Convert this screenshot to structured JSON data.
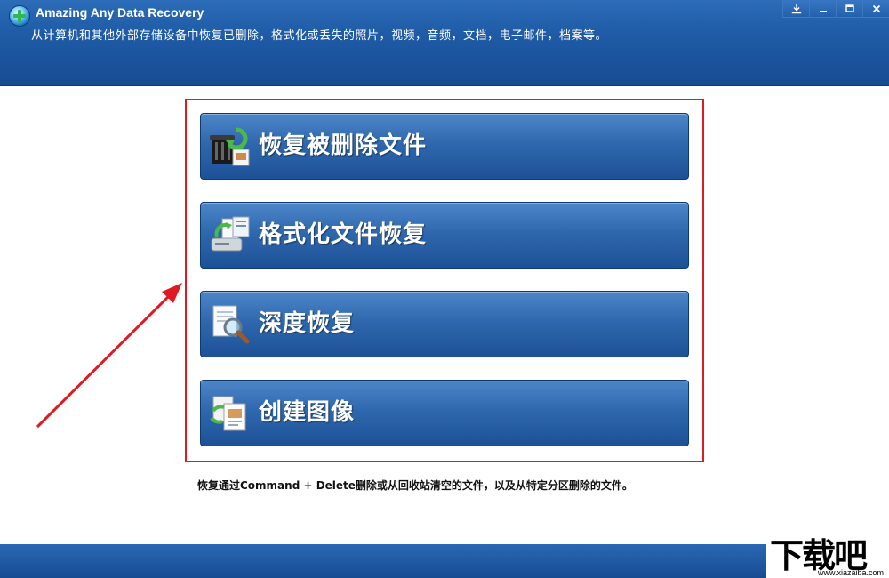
{
  "window": {
    "title": "Amazing Any Data Recovery",
    "subtitle": "从计算机和其他外部存储设备中恢复已删除，格式化或丢失的照片，视频，音频，文档，电子邮件，档案等。",
    "controls": [
      "download-icon",
      "minimize-icon",
      "maximize-icon",
      "close-icon"
    ]
  },
  "actions": [
    {
      "label": "恢复被删除文件",
      "icon": "recycle-bin-restore-icon"
    },
    {
      "label": "格式化文件恢复",
      "icon": "drive-restore-icon"
    },
    {
      "label": "深度恢复",
      "icon": "magnifier-document-icon"
    },
    {
      "label": "创建图像",
      "icon": "image-copy-icon"
    }
  ],
  "description": "恢复通过Command + Delete删除或从回收站清空的文件，以及从特定分区删除的文件。",
  "watermark": {
    "main": "下载吧",
    "sub": "www.xiazaiba.com"
  },
  "colors": {
    "header": "#1f5ba6",
    "button": "#2f68ae",
    "highlight": "#e01a22"
  }
}
